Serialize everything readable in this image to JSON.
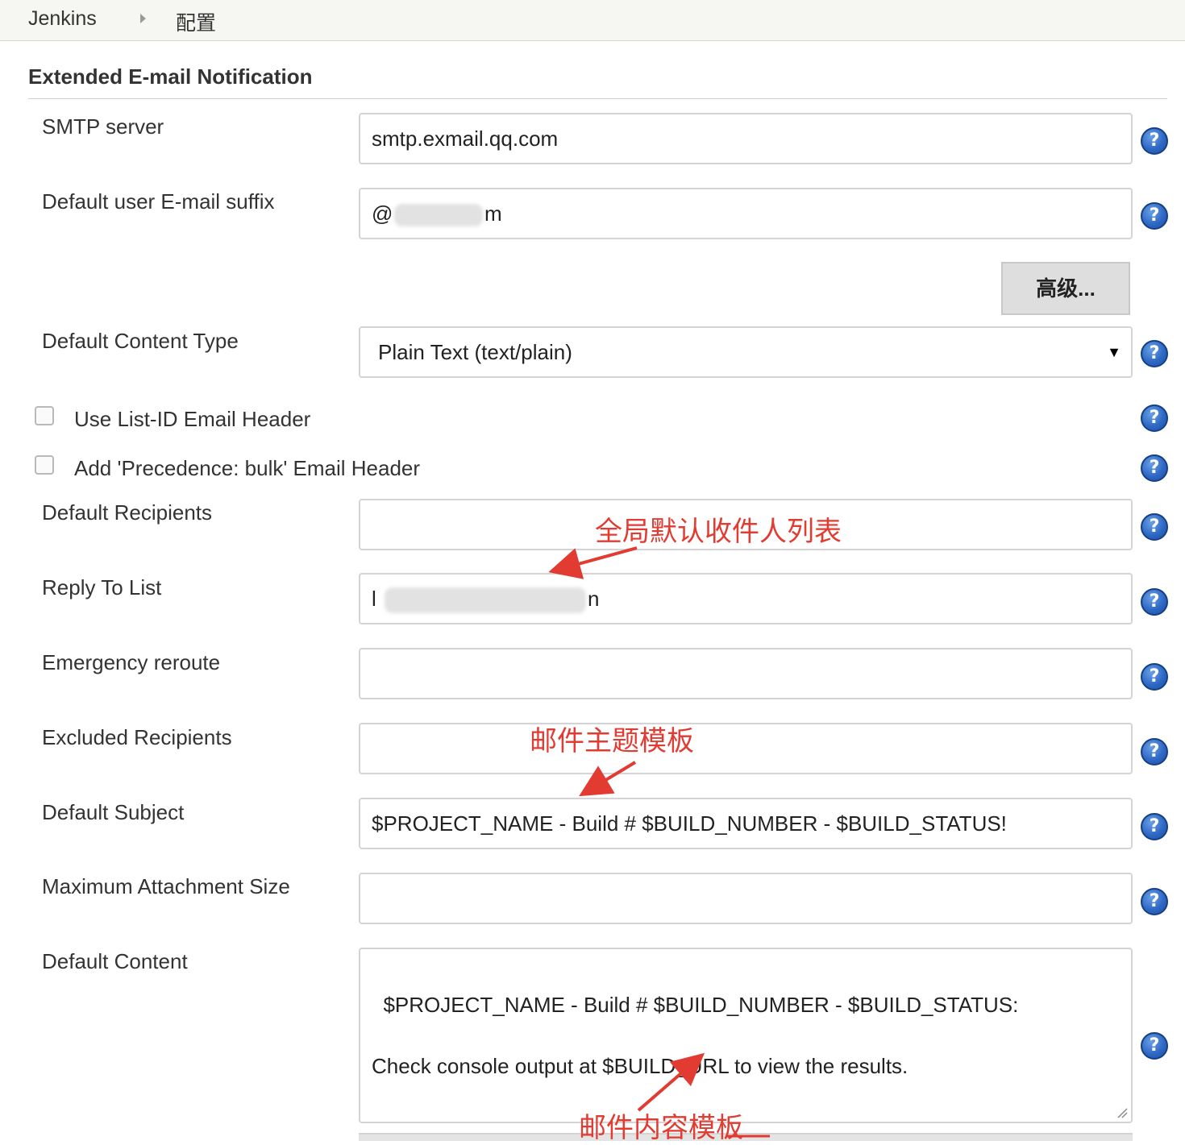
{
  "breadcrumb": {
    "home": "Jenkins",
    "current": "配置"
  },
  "section": {
    "title": "Extended E-mail Notification"
  },
  "fields": {
    "smtp_server": {
      "label": "SMTP server",
      "value": "smtp.exmail.qq.com"
    },
    "email_suffix": {
      "label": "Default user E-mail suffix",
      "value_start": "@",
      "value_end": "m"
    },
    "advanced_button": "高级...",
    "content_type": {
      "label": "Default Content Type",
      "value": "Plain Text (text/plain)",
      "arrow": "▼"
    },
    "use_list_id": {
      "label": "Use List-ID Email Header",
      "checked": false
    },
    "add_precedence": {
      "label": "Add 'Precedence: bulk' Email Header",
      "checked": false
    },
    "default_recipients": {
      "label": "Default Recipients",
      "value": ""
    },
    "reply_to": {
      "label": "Reply To List",
      "value_start": "l",
      "value_end": "n"
    },
    "emergency_reroute": {
      "label": "Emergency reroute",
      "value": ""
    },
    "excluded_recipients": {
      "label": "Excluded Recipients",
      "value": ""
    },
    "default_subject": {
      "label": "Default Subject",
      "value": "$PROJECT_NAME - Build # $BUILD_NUMBER - $BUILD_STATUS!"
    },
    "max_attachment": {
      "label": "Maximum Attachment Size",
      "value": ""
    },
    "default_content": {
      "label": "Default Content",
      "value": "$PROJECT_NAME - Build # $BUILD_NUMBER - $BUILD_STATUS:\n\nCheck console output at $BUILD_URL to view the results."
    }
  },
  "help_icon_glyph": "?",
  "annotations": {
    "recipients_note": "全局默认收件人列表",
    "subject_note": "邮件主题模板",
    "content_note": "邮件内容模板"
  },
  "colors": {
    "annotation": "#e23b32",
    "help_icon": "#2f69c6",
    "breadcrumb_bg": "#f6f7f2"
  }
}
